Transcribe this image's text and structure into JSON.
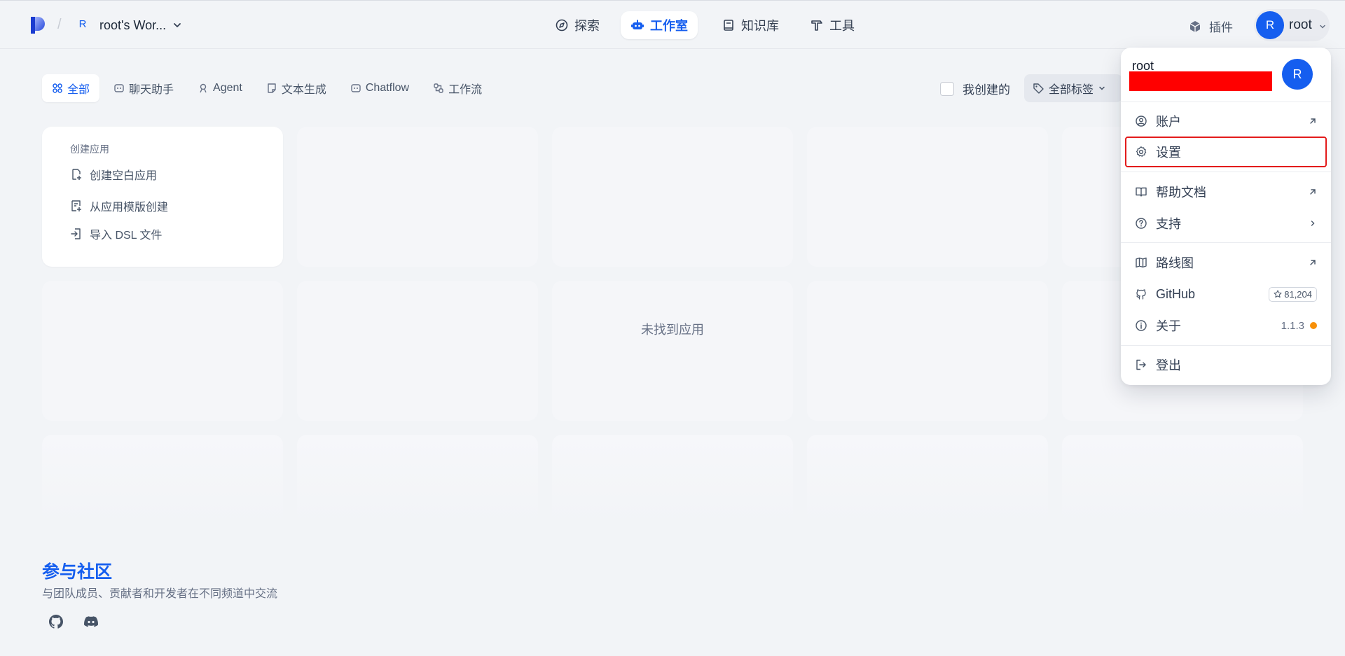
{
  "header": {
    "workspace_initial": "R",
    "workspace_name": "root's Wor...",
    "nav": [
      {
        "label": "探索",
        "icon": "compass-icon"
      },
      {
        "label": "工作室",
        "icon": "robot-icon"
      },
      {
        "label": "知识库",
        "icon": "book-icon"
      },
      {
        "label": "工具",
        "icon": "hammer-icon"
      }
    ],
    "plugin_label": "插件",
    "user_initial": "R",
    "user_name": "root"
  },
  "filters": {
    "tabs": [
      {
        "label": "全部",
        "icon": "grid-icon"
      },
      {
        "label": "聊天助手",
        "icon": "chat-bot-icon"
      },
      {
        "label": "Agent",
        "icon": "agent-icon"
      },
      {
        "label": "文本生成",
        "icon": "note-icon"
      },
      {
        "label": "Chatflow",
        "icon": "chatflow-icon"
      },
      {
        "label": "工作流",
        "icon": "workflow-icon"
      }
    ],
    "mine_label": "我创建的",
    "tag_filter_label": "全部标签"
  },
  "create_card": {
    "title": "创建应用",
    "items": [
      {
        "label": "创建空白应用",
        "icon": "file-plus-icon"
      },
      {
        "label": "从应用模版创建",
        "icon": "template-icon"
      },
      {
        "label": "导入 DSL 文件",
        "icon": "import-icon"
      }
    ]
  },
  "empty_text": "未找到应用",
  "community": {
    "title": "参与社区",
    "description": "与团队成员、贡献者和开发者在不同频道中交流"
  },
  "dropdown": {
    "user_name": "root",
    "avatar_initial": "R",
    "items": [
      {
        "label": "账户",
        "icon": "user-circle-icon",
        "right": "arrow-up-right-icon"
      },
      {
        "label": "设置",
        "icon": "gear-icon"
      },
      {
        "label": "帮助文档",
        "icon": "book-open-icon",
        "right": "arrow-up-right-icon"
      },
      {
        "label": "支持",
        "icon": "question-circle-icon",
        "right": "chevron-right-icon"
      },
      {
        "label": "路线图",
        "icon": "map-icon",
        "right": "arrow-up-right-icon"
      },
      {
        "label": "GitHub",
        "icon": "github-icon",
        "stars": "81,204"
      },
      {
        "label": "关于",
        "icon": "info-icon",
        "version": "1.1.3"
      },
      {
        "label": "登出",
        "icon": "logout-icon"
      }
    ]
  },
  "colors": {
    "accent": "#155eef",
    "background": "#f2f4f7",
    "highlight_outline": "#e31b1b",
    "redaction": "#ff0000",
    "update_dot": "#f79009"
  }
}
